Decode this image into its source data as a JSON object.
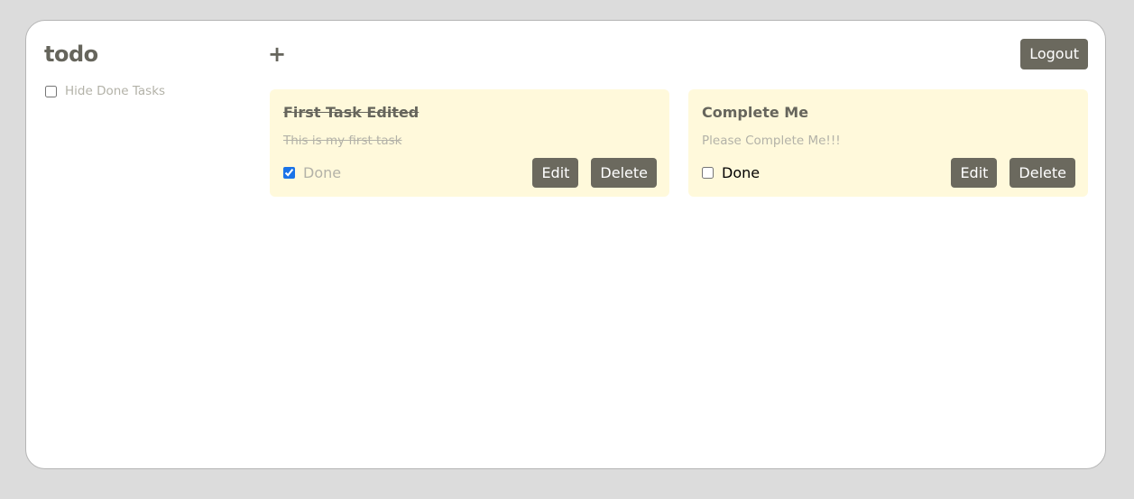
{
  "app": {
    "title": "todo",
    "add_label": "+",
    "logout_label": "Logout"
  },
  "sidebar": {
    "hide_done_label": "Hide Done Tasks",
    "hide_done_checked": false
  },
  "tasks": [
    {
      "title": "First Task Edited",
      "description": "This is my first task",
      "done_label": "Done",
      "done": true,
      "edit_label": "Edit",
      "delete_label": "Delete"
    },
    {
      "title": "Complete Me",
      "description": "Please Complete Me!!!",
      "done_label": "Done",
      "done": false,
      "edit_label": "Edit",
      "delete_label": "Delete"
    }
  ],
  "colors": {
    "background": "#dcdcdc",
    "card": "#fff9db",
    "button": "#6b695e",
    "title_text": "#66655c",
    "muted_text": "#b3b2a8"
  }
}
